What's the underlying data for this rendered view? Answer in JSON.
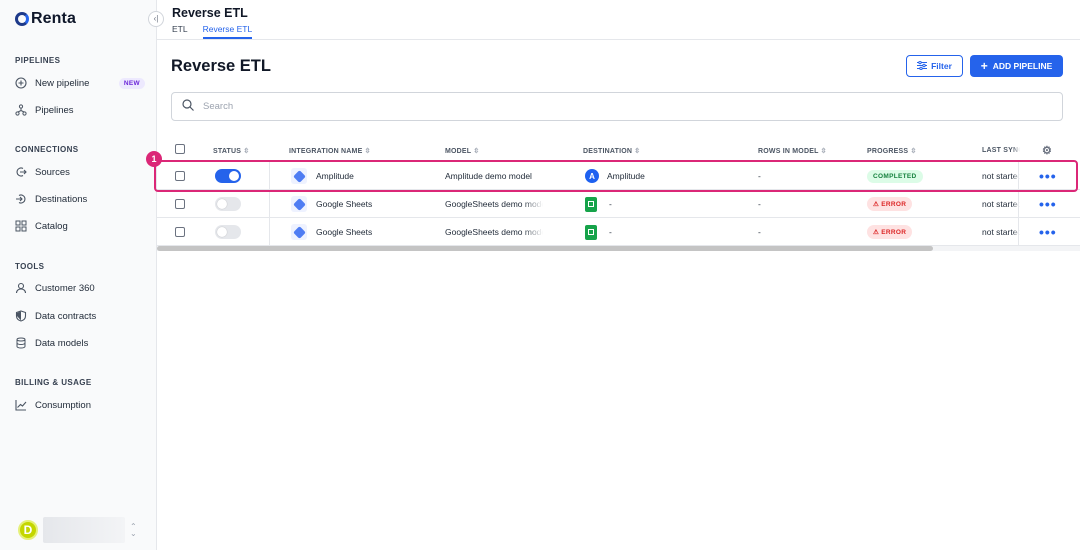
{
  "brand": {
    "name": "Renta"
  },
  "sidebar": {
    "sections": [
      {
        "title": "PIPELINES",
        "items": [
          {
            "label": "New pipeline",
            "icon": "plus-circle-icon",
            "badge": "NEW"
          },
          {
            "label": "Pipelines",
            "icon": "network-icon"
          }
        ]
      },
      {
        "title": "CONNECTIONS",
        "items": [
          {
            "label": "Sources",
            "icon": "sources-icon"
          },
          {
            "label": "Destinations",
            "icon": "destinations-icon"
          },
          {
            "label": "Catalog",
            "icon": "grid-icon"
          }
        ]
      },
      {
        "title": "TOOLS",
        "items": [
          {
            "label": "Customer 360",
            "icon": "user-icon"
          },
          {
            "label": "Data contracts",
            "icon": "shield-icon"
          },
          {
            "label": "Data models",
            "icon": "database-icon"
          }
        ]
      },
      {
        "title": "BILLING & USAGE",
        "items": [
          {
            "label": "Consumption",
            "icon": "chart-line-icon"
          }
        ]
      }
    ],
    "user": {
      "initial": "D"
    }
  },
  "header": {
    "title": "Reverse ETL",
    "tabs": [
      {
        "label": "ETL",
        "active": false
      },
      {
        "label": "Reverse ETL",
        "active": true
      }
    ]
  },
  "main": {
    "title": "Reverse ETL",
    "filter_label": "Filter",
    "add_label": "ADD PIPELINE",
    "search_placeholder": "Search"
  },
  "table": {
    "columns": [
      "STATUS",
      "INTEGRATION NAME",
      "MODEL",
      "DESTINATION",
      "ROWS IN MODEL",
      "PROGRESS",
      "LAST SYNC"
    ],
    "rows": [
      {
        "enabled": true,
        "integration": "Amplitude",
        "model": "Amplitude demo model",
        "destination": "Amplitude",
        "destination_icon": "amplitude-icon",
        "rows": "-",
        "progress": "COMPLETED",
        "progress_type": "completed",
        "last_sync": "not started"
      },
      {
        "enabled": false,
        "integration": "Google Sheets",
        "model": "GoogleSheets demo model",
        "destination": "-",
        "destination_icon": "google-sheets-icon",
        "rows": "-",
        "progress": "⚠ ERROR",
        "progress_type": "error",
        "last_sync": "not started"
      },
      {
        "enabled": false,
        "integration": "Google Sheets",
        "model": "GoogleSheets demo model",
        "destination": "-",
        "destination_icon": "google-sheets-icon",
        "rows": "-",
        "progress": "⚠ ERROR",
        "progress_type": "error",
        "last_sync": "not started"
      }
    ]
  },
  "annotation": {
    "marker": "1",
    "color": "#db2777"
  },
  "colors": {
    "accent": "#2563eb",
    "success": "#15803d",
    "error": "#dc2626"
  }
}
